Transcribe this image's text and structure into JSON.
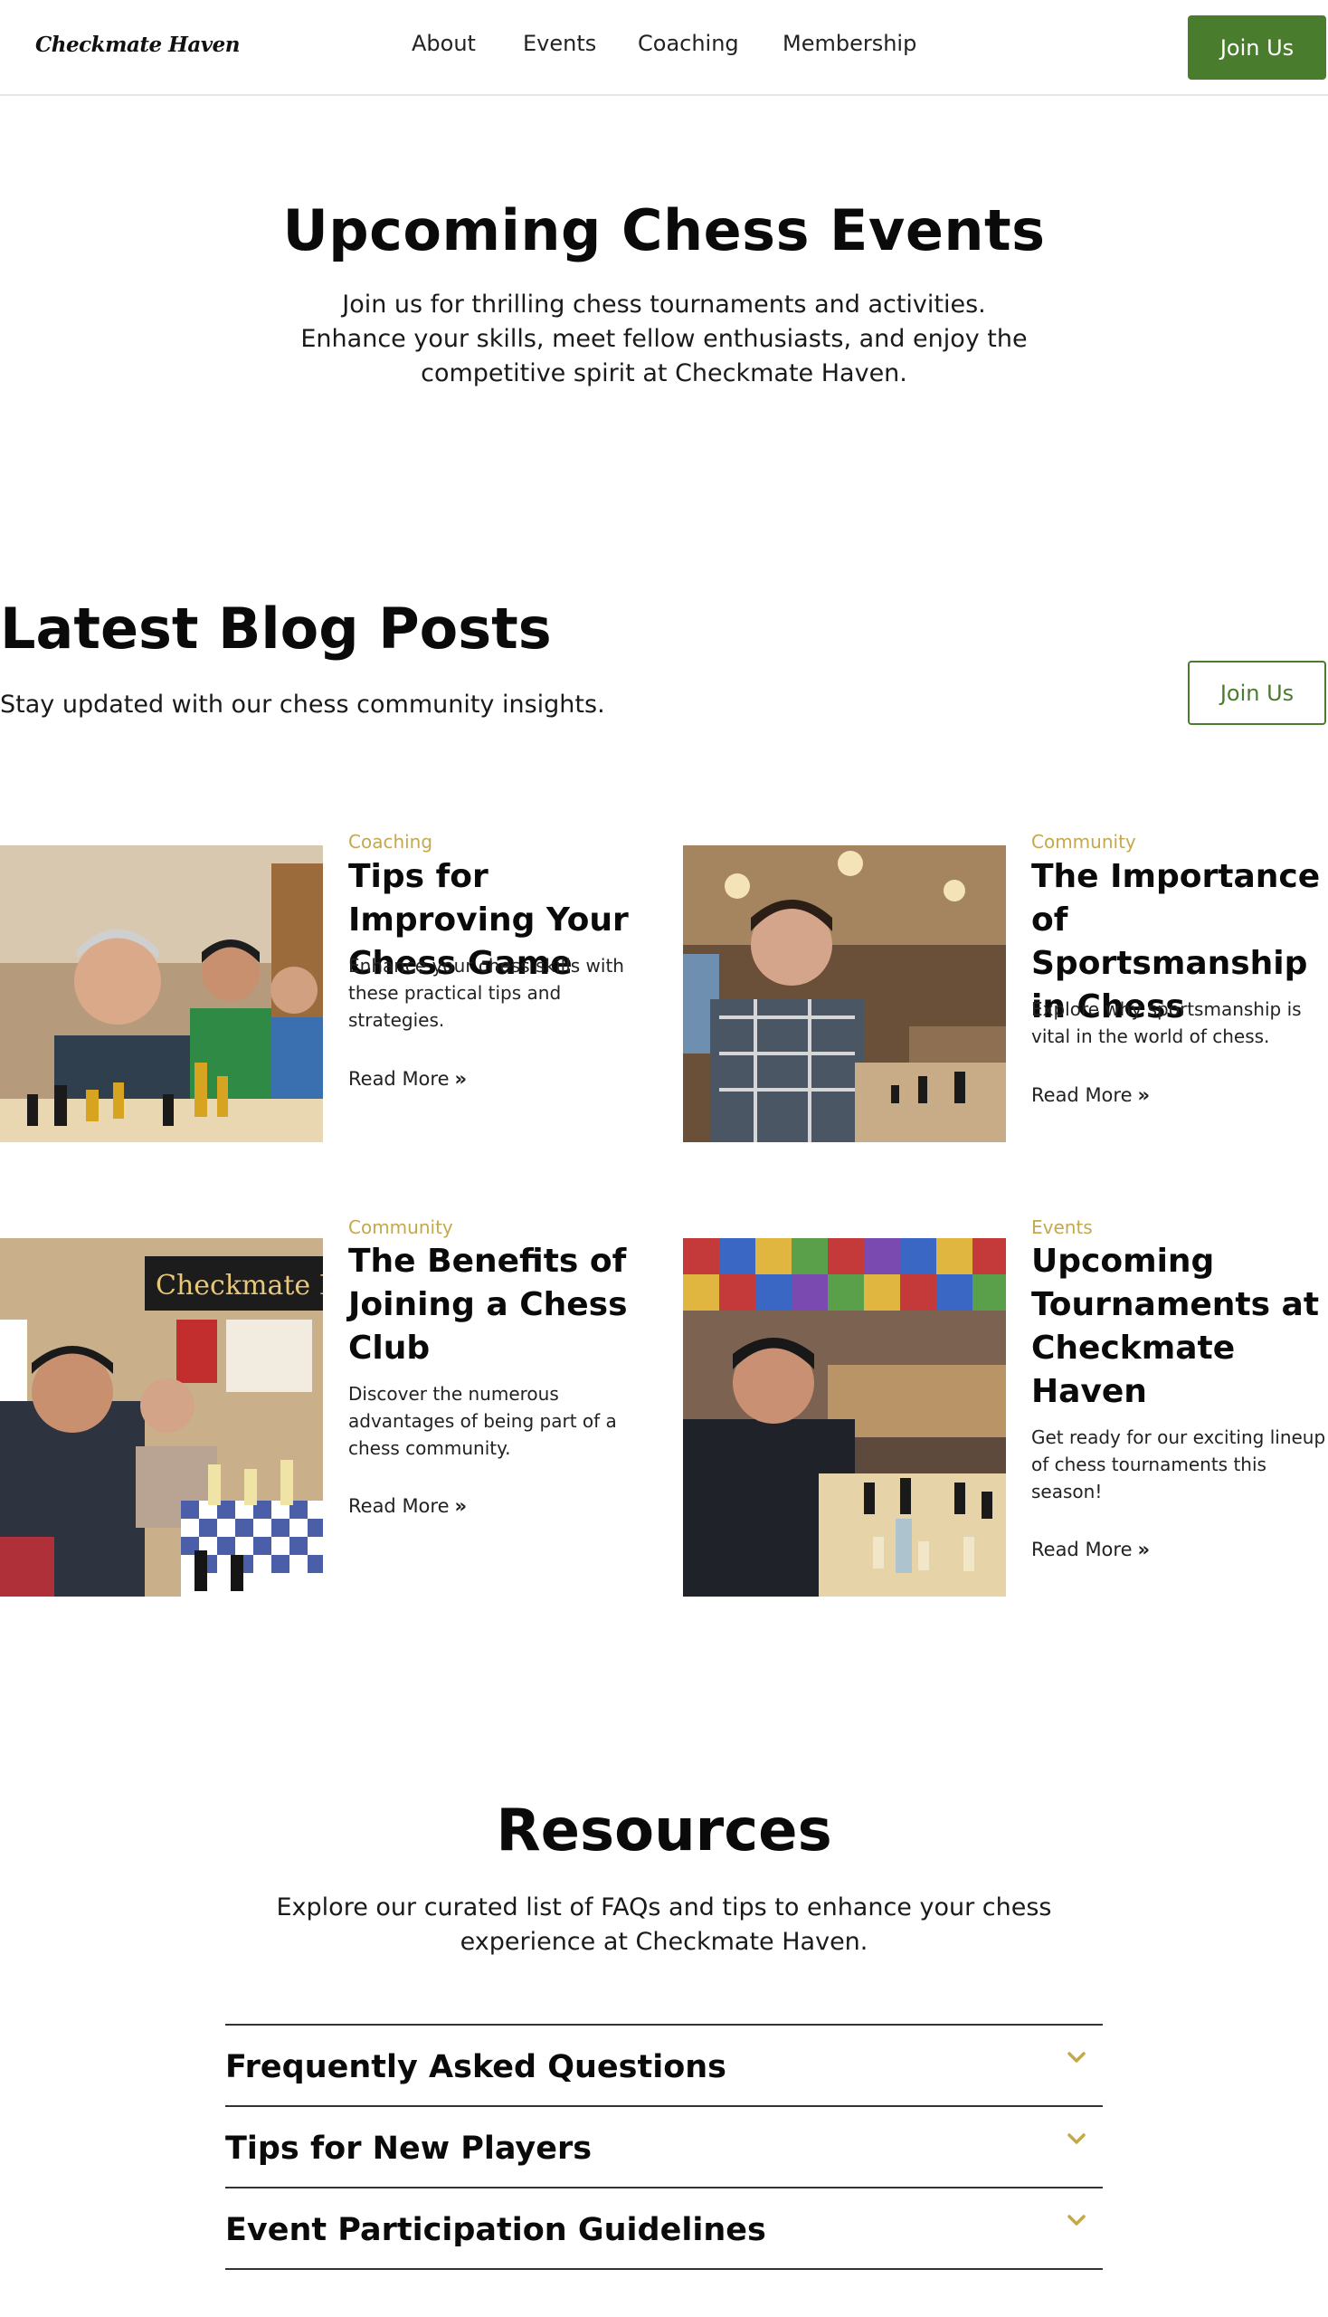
{
  "header": {
    "logo": "Checkmate Haven",
    "nav": [
      "About",
      "Events",
      "Coaching",
      "Membership"
    ],
    "cta": "Join Us"
  },
  "hero": {
    "title": "Upcoming Chess Events",
    "text": "Join us for thrilling chess tournaments and activities. Enhance your skills, meet fellow enthusiasts, and enjoy the competitive spirit at Checkmate Haven."
  },
  "blog": {
    "title": "Latest Blog Posts",
    "subtitle": "Stay updated with our chess community insights.",
    "cta": "Join Us",
    "read_more": "Read More",
    "posts": [
      {
        "category": "Coaching",
        "title": "Tips for Improving Your Chess Game",
        "desc": "Enhance your chess skills with these practical tips and strategies."
      },
      {
        "category": "Community",
        "title": "The Importance of Sportsmanship in Chess",
        "desc": "Explore why sportsmanship is vital in the world of chess."
      },
      {
        "category": "Community",
        "title": "The Benefits of Joining a Chess Club",
        "desc": "Discover the numerous advantages of being part of a chess community."
      },
      {
        "category": "Events",
        "title": "Upcoming Tournaments at Checkmate Haven",
        "desc": "Get ready for our exciting lineup of chess tournaments this season!"
      }
    ],
    "photo_sign_text": "Checkmate Ha"
  },
  "resources": {
    "title": "Resources",
    "text": "Explore our curated list of FAQs and tips to enhance your chess experience at Checkmate Haven.",
    "items": [
      "Frequently Asked Questions",
      "Tips for New Players",
      "Event Participation Guidelines"
    ]
  },
  "colors": {
    "accent_green": "#4a7c2e",
    "category_gold": "#c5a84b",
    "chevron_gold": "#c5a84b"
  },
  "icons": {
    "read_more": "double-chevron-right-icon",
    "accordion": "chevron-down-icon"
  }
}
